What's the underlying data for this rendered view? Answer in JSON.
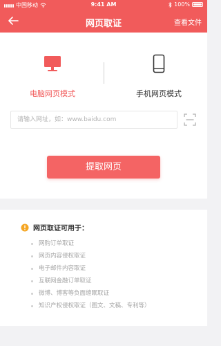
{
  "status_bar": {
    "carrier": "中国移动",
    "time": "9:41 AM",
    "battery": "100%"
  },
  "nav": {
    "title": "网页取证",
    "right_action": "查看文件",
    "back_icon": "arrow-left-icon"
  },
  "modes": [
    {
      "label": "电脑网页模式",
      "icon": "monitor-icon",
      "selected": true
    },
    {
      "label": "手机网页模式",
      "icon": "phone-icon",
      "selected": false
    }
  ],
  "url_input": {
    "value": "",
    "placeholder": "请输入网址，如：www.baidu.com",
    "scan_icon": "scan-icon"
  },
  "submit": {
    "label": "提取网页"
  },
  "info": {
    "icon": "info-icon",
    "title": "网页取证可用于：",
    "items": [
      "网购订单取证",
      "网页内容侵权取证",
      "电子邮件内容取证",
      "互联网金融订单取证",
      "微博、博客等负面缠眠取证",
      "知识产权侵权取证（图文、文稿、专利等）"
    ]
  },
  "colors": {
    "brand": "#f15b5b",
    "button": "#f46464",
    "info_icon": "#f5a623",
    "background": "#f2f2f4"
  }
}
